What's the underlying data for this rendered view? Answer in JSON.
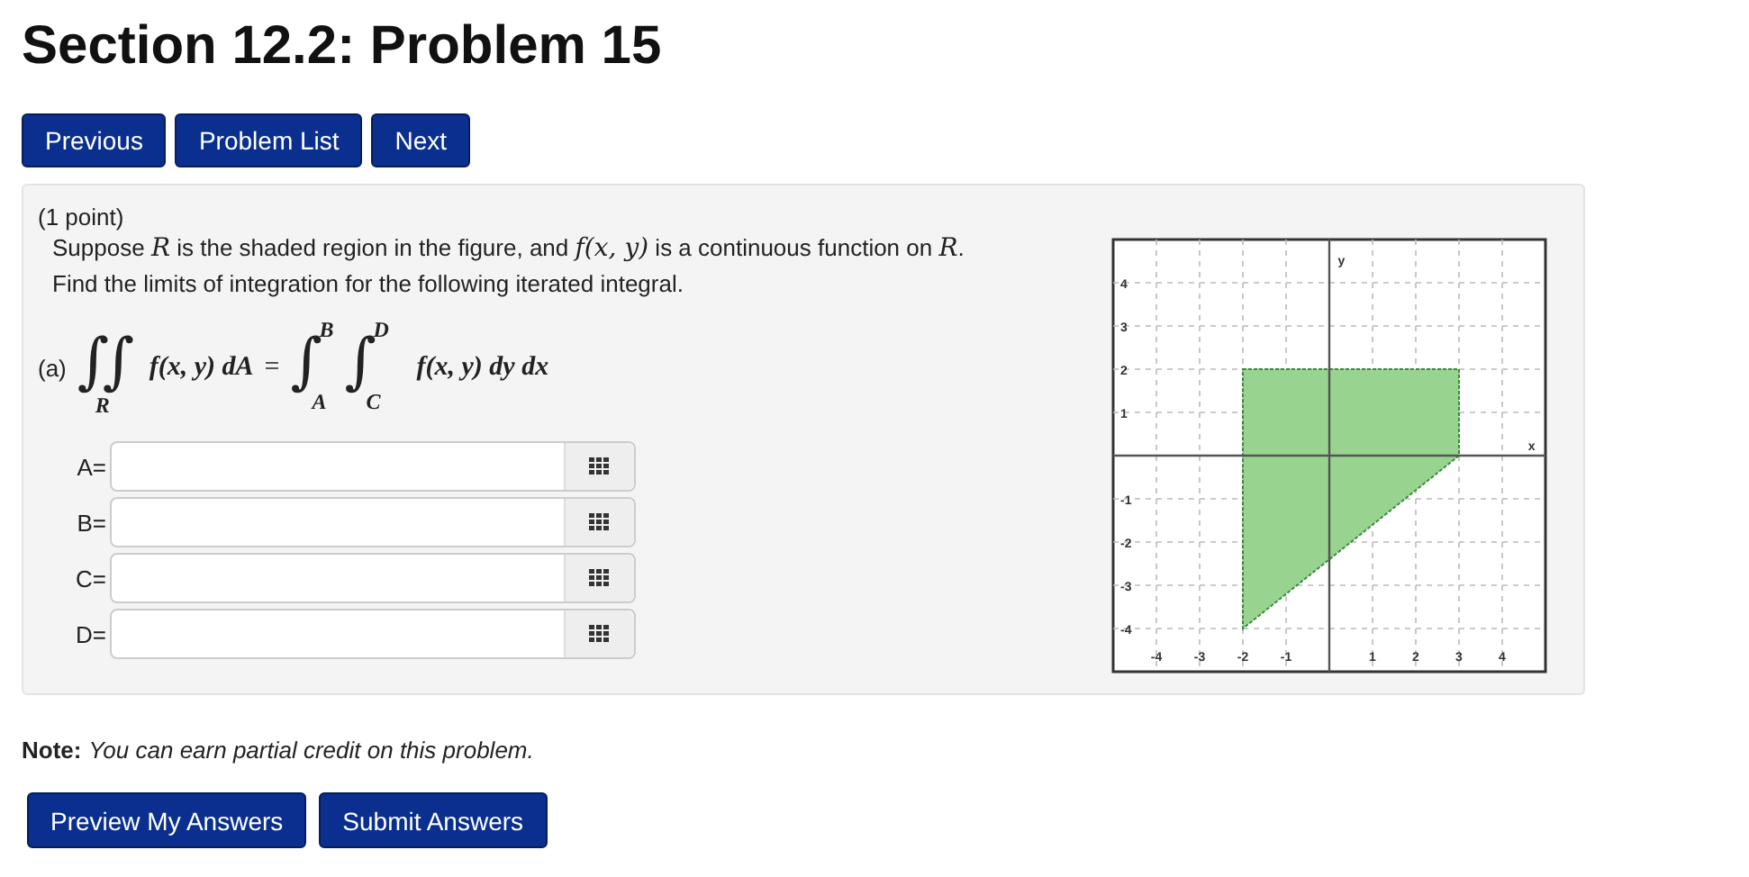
{
  "title": "Section 12.2: Problem 15",
  "nav_buttons": [
    "Previous",
    "Problem List",
    "Next"
  ],
  "problem": {
    "points": "(1 point)",
    "statement": [
      "Suppose *R* is the shaded region in the figure, and *f(x, y)* is a continuous function on *R*.",
      "Find the limits of integration for the following iterated integral."
    ],
    "part_label": "(a)",
    "integral": {
      "sign": "∫",
      "region": "R",
      "lhs": "f(x, y) dA",
      "equals": "=",
      "outer_lower": "A",
      "outer_upper": "B",
      "inner_lower": "C",
      "inner_upper": "D",
      "integrand": "f(x, y) dy dx"
    },
    "answers": [
      {
        "label": "A="
      },
      {
        "label": "B="
      },
      {
        "label": "C="
      },
      {
        "label": "D="
      }
    ],
    "figure": {
      "x_axis_label": "x",
      "y_axis_label": "y",
      "x_ticks": [
        "-4",
        "-3",
        "-2",
        "-1",
        "1",
        "2",
        "3",
        "4"
      ],
      "y_ticks": [
        "4",
        "3",
        "2",
        "1",
        "-1",
        "-2",
        "-3",
        "-4"
      ]
    }
  },
  "note": {
    "label": "Note:",
    "text": "You can earn partial credit on this problem."
  },
  "submit_buttons": [
    "Preview My Answers",
    "Submit Answers"
  ]
}
